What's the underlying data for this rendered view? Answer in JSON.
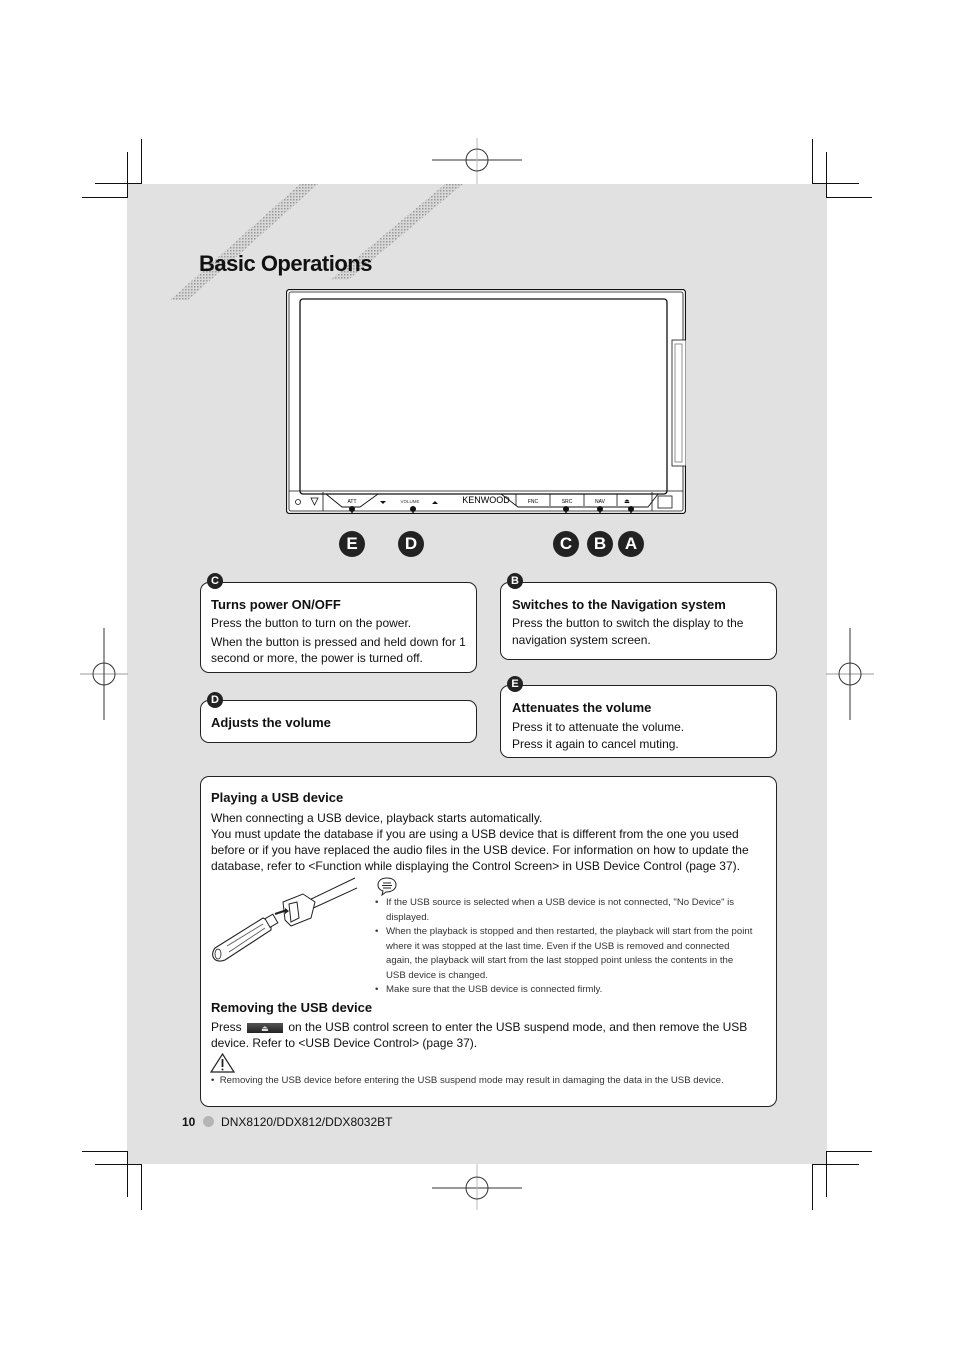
{
  "page": {
    "title": "Basic Operations",
    "page_number": "10",
    "model": "DNX8120/DDX812/DDX8032BT"
  },
  "device": {
    "brand": "KENWOOD",
    "buttons": {
      "att": "ATT",
      "volume": "VOLUME",
      "fnc": "FNC",
      "src": "SRC",
      "nav": "NAV",
      "eject": "⏏"
    },
    "callouts": [
      "E",
      "D",
      "C",
      "B",
      "A"
    ]
  },
  "sections": {
    "c": {
      "badge": "C",
      "heading": "Turns power ON/OFF",
      "lines": [
        "Press the button to turn on the power.",
        "When the button is pressed and held down for 1 second or more, the power is turned off."
      ]
    },
    "b": {
      "badge": "B",
      "heading": "Switches to the Navigation system",
      "lines": [
        "Press the button to switch the display to the navigation system screen."
      ]
    },
    "d": {
      "badge": "D",
      "heading": "Adjusts the volume"
    },
    "e": {
      "badge": "E",
      "heading": "Attenuates the volume",
      "lines": [
        "Press it to attenuate the volume.",
        "Press it again to cancel muting."
      ]
    }
  },
  "usb": {
    "heading": "Playing a USB device",
    "para1": "When connecting a USB device, playback starts automatically.",
    "para2": "You must update the database if you are using a USB device that is different from the one you used before or if you have replaced the audio files in the USB device. For information on how to update the database, refer to <Function while displaying the Control Screen> in USB Device Control (page 37).",
    "notes": [
      "If the USB source is selected when a USB device is not connected, \"No Device\" is displayed.",
      "When the playback is stopped and then restarted, the playback will start from the point where it was stopped at the last time. Even if the USB is removed and connected again, the playback will start from the last stopped point unless the contents in the USB device is changed.",
      "Make sure that the USB device is connected firmly."
    ],
    "remove_heading": "Removing the USB device",
    "remove_pre": "Press",
    "remove_post": "on the USB control screen to enter the USB suspend mode, and then remove the USB device. Refer to <USB Device Control> (page 37).",
    "caution": "Removing the USB device before entering the USB suspend mode may result in damaging the data in the USB device."
  }
}
